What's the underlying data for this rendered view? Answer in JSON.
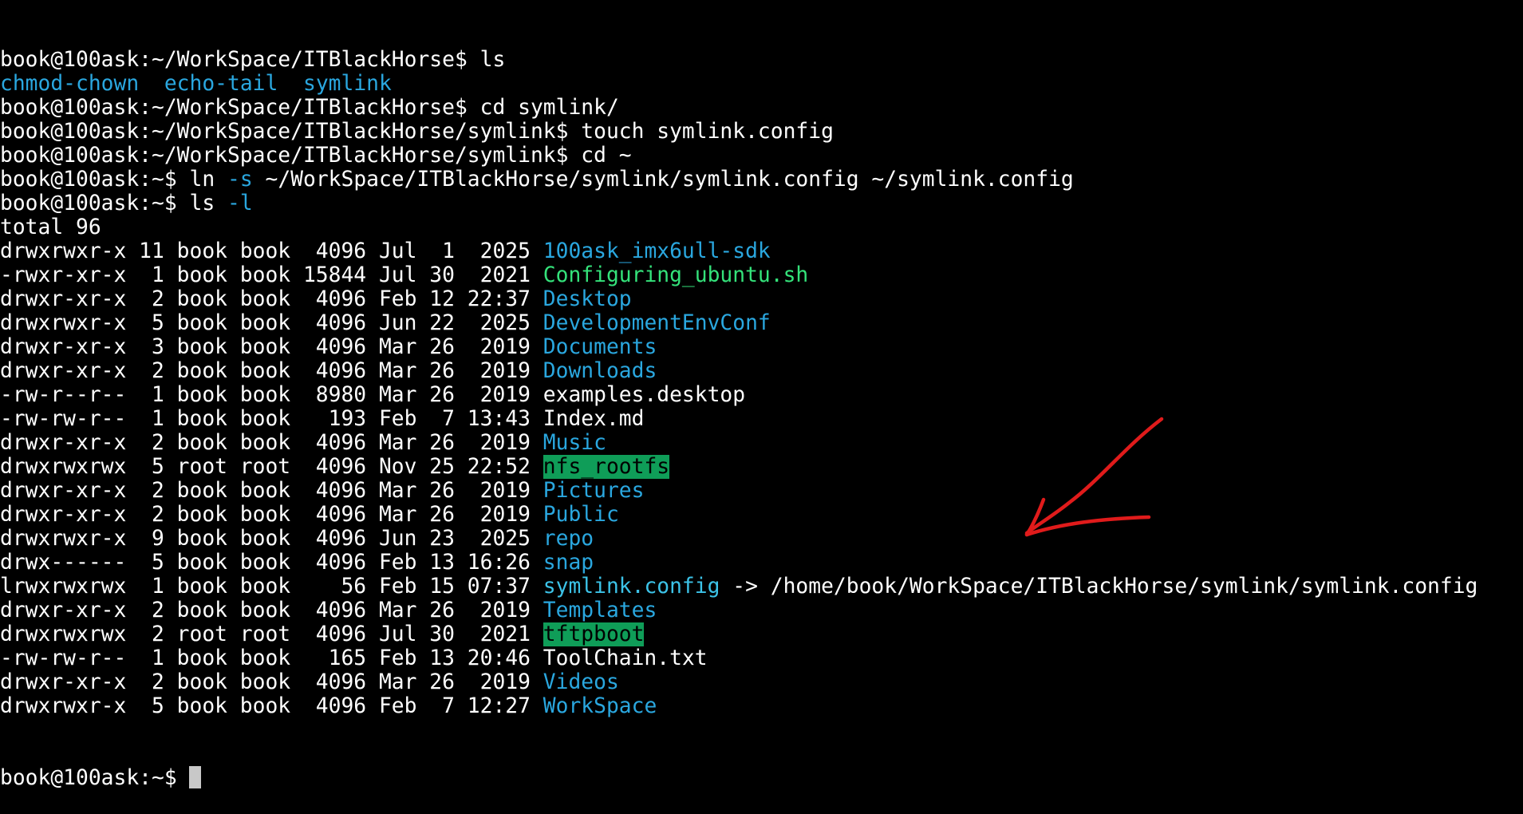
{
  "terminal": {
    "colors": {
      "background": "#000000",
      "default_text": "#ffffff",
      "directory": "#2aa7df",
      "executable": "#34e27a",
      "symlink": "#3cc3e8",
      "highlight_bg": "#0f9d58",
      "annotation_arrow": "#e01b1b"
    },
    "lines": [
      [
        {
          "t": "book@100ask:~/WorkSpace/ITBlackHorse$ ls",
          "c": "default"
        }
      ],
      [
        {
          "t": "chmod-chown",
          "c": "dir"
        },
        {
          "t": "  ",
          "c": "default"
        },
        {
          "t": "echo-tail",
          "c": "dir"
        },
        {
          "t": "  ",
          "c": "default"
        },
        {
          "t": "symlink",
          "c": "dir"
        }
      ],
      [
        {
          "t": "book@100ask:~/WorkSpace/ITBlackHorse$ cd symlink/",
          "c": "default"
        }
      ],
      [
        {
          "t": "book@100ask:~/WorkSpace/ITBlackHorse/symlink$ touch symlink.config",
          "c": "default"
        }
      ],
      [
        {
          "t": "book@100ask:~/WorkSpace/ITBlackHorse/symlink$ cd ~",
          "c": "default"
        }
      ],
      [
        {
          "t": "book@100ask:~$ ln ",
          "c": "default"
        },
        {
          "t": "-s",
          "c": "opt"
        },
        {
          "t": " ~/WorkSpace/ITBlackHorse/symlink/symlink.config ~/symlink.config",
          "c": "default"
        }
      ],
      [
        {
          "t": "book@100ask:~$ ls ",
          "c": "default"
        },
        {
          "t": "-l",
          "c": "opt"
        }
      ],
      [
        {
          "t": "total 96",
          "c": "default"
        }
      ],
      [
        {
          "t": "drwxrwxr-x 11 book book  4096 Jul  1  2025 ",
          "c": "default"
        },
        {
          "t": "100ask_imx6ull-sdk",
          "c": "dir"
        }
      ],
      [
        {
          "t": "-rwxr-xr-x  1 book book 15844 Jul 30  2021 ",
          "c": "default"
        },
        {
          "t": "Configuring_ubuntu.sh",
          "c": "exec"
        }
      ],
      [
        {
          "t": "drwxr-xr-x  2 book book  4096 Feb 12 22:37 ",
          "c": "default"
        },
        {
          "t": "Desktop",
          "c": "dir"
        }
      ],
      [
        {
          "t": "drwxrwxr-x  5 book book  4096 Jun 22  2025 ",
          "c": "default"
        },
        {
          "t": "DevelopmentEnvConf",
          "c": "dir"
        }
      ],
      [
        {
          "t": "drwxr-xr-x  3 book book  4096 Mar 26  2019 ",
          "c": "default"
        },
        {
          "t": "Documents",
          "c": "dir"
        }
      ],
      [
        {
          "t": "drwxr-xr-x  2 book book  4096 Mar 26  2019 ",
          "c": "default"
        },
        {
          "t": "Downloads",
          "c": "dir"
        }
      ],
      [
        {
          "t": "-rw-r--r--  1 book book  8980 Mar 26  2019 examples.desktop",
          "c": "default"
        }
      ],
      [
        {
          "t": "-rw-rw-r--  1 book book   193 Feb  7 13:43 Index.md",
          "c": "default"
        }
      ],
      [
        {
          "t": "drwxr-xr-x  2 book book  4096 Mar 26  2019 ",
          "c": "default"
        },
        {
          "t": "Music",
          "c": "dir"
        }
      ],
      [
        {
          "t": "drwxrwxrwx  5 root root  4096 Nov 25 22:52 ",
          "c": "default"
        },
        {
          "t": "nfs_rootfs",
          "c": "hl"
        }
      ],
      [
        {
          "t": "drwxr-xr-x  2 book book  4096 Mar 26  2019 ",
          "c": "default"
        },
        {
          "t": "Pictures",
          "c": "dir"
        }
      ],
      [
        {
          "t": "drwxr-xr-x  2 book book  4096 Mar 26  2019 ",
          "c": "default"
        },
        {
          "t": "Public",
          "c": "dir"
        }
      ],
      [
        {
          "t": "drwxrwxr-x  9 book book  4096 Jun 23  2025 ",
          "c": "default"
        },
        {
          "t": "repo",
          "c": "dir"
        }
      ],
      [
        {
          "t": "drwx------  5 book book  4096 Feb 13 16:26 ",
          "c": "default"
        },
        {
          "t": "snap",
          "c": "dir"
        }
      ],
      [
        {
          "t": "lrwxrwxrwx  1 book book    56 Feb 15 07:37 ",
          "c": "default"
        },
        {
          "t": "symlink.config",
          "c": "link"
        },
        {
          "t": " -> /home/book/WorkSpace/ITBlackHorse/symlink/symlink.config",
          "c": "default"
        }
      ],
      [
        {
          "t": "drwxr-xr-x  2 book book  4096 Mar 26  2019 ",
          "c": "default"
        },
        {
          "t": "Templates",
          "c": "dir"
        }
      ],
      [
        {
          "t": "drwxrwxrwx  2 root root  4096 Jul 30  2021 ",
          "c": "default"
        },
        {
          "t": "tftpboot",
          "c": "hl"
        }
      ],
      [
        {
          "t": "-rw-rw-r--  1 book book   165 Feb 13 20:46 ToolChain.txt",
          "c": "default"
        }
      ],
      [
        {
          "t": "drwxr-xr-x  2 book book  4096 Mar 26  2019 ",
          "c": "default"
        },
        {
          "t": "Videos",
          "c": "dir"
        }
      ],
      [
        {
          "t": "drwxrwxr-x  5 book book  4096 Feb  7 12:27 ",
          "c": "default"
        },
        {
          "t": "WorkSpace",
          "c": "dir"
        }
      ]
    ],
    "prompt": "book@100ask:~$ ",
    "annotation_icon": "red-arrow-icon"
  }
}
